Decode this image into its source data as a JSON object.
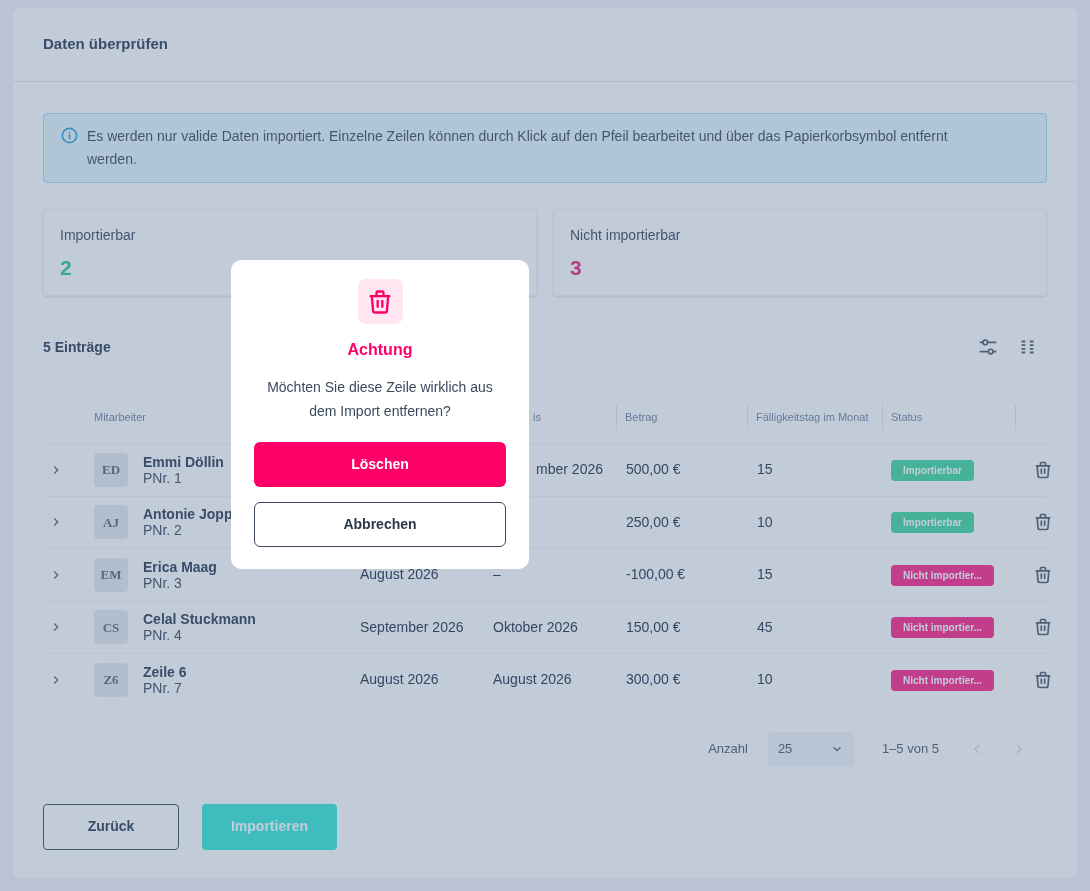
{
  "title": "Daten überprüfen",
  "info": "Es werden nur valide Daten importiert. Einzelne Zeilen können durch Klick auf den Pfeil bearbeitet und über das Papierkorbsymbol entfernt werden.",
  "stats": [
    {
      "label": "Importierbar",
      "value": "2",
      "kind": "ok"
    },
    {
      "label": "Nicht importierbar",
      "value": "3",
      "kind": "error"
    }
  ],
  "entries": "5 Einträge",
  "table": {
    "columns": {
      "employee": "Mitarbeiter",
      "column_4": {
        "label": "is",
        "cut": true
      },
      "amount": "Betrag",
      "due_day": "Fälligkeitstag im Monat",
      "status": "Status"
    },
    "rows": [
      {
        "initials": "ED",
        "name": "Emmi Döllin",
        "pnr": "PNr. 1",
        "column_4": "mber 2026",
        "column_4_cut": true,
        "amount": "500,00 €",
        "due_day": "15",
        "status": {
          "label": "Importierbar",
          "kind": "ok"
        }
      },
      {
        "initials": "AJ",
        "name": "Antonie Jopp",
        "pnr": "PNr. 2",
        "amount": "250,00 €",
        "due_day": "10",
        "status": {
          "label": "Importierbar",
          "kind": "ok"
        }
      },
      {
        "initials": "EM",
        "name": "Erica Maag",
        "pnr": "PNr. 3",
        "column_3": "August 2026",
        "column_4": "–",
        "column_4_cut": false,
        "amount": "-100,00 €",
        "due_day": "15",
        "status": {
          "label": "Nicht importier...",
          "kind": "error"
        }
      },
      {
        "initials": "CS",
        "name": "Celal Stuckmann",
        "pnr": "PNr. 4",
        "column_3": "September 2026",
        "column_4": "Oktober 2026",
        "column_4_cut": false,
        "amount": "150,00 €",
        "due_day": "45",
        "status": {
          "label": "Nicht importier...",
          "kind": "error"
        }
      },
      {
        "initials": "Z6",
        "name": "Zeile 6",
        "pnr": "PNr. 7",
        "column_3": "August 2026",
        "column_4": "August 2026",
        "column_4_cut": false,
        "amount": "300,00 €",
        "due_day": "10",
        "status": {
          "label": "Nicht importier...",
          "kind": "error"
        }
      }
    ]
  },
  "pagination": {
    "label": "Anzahl",
    "page_size": "25",
    "range": "1–5 von 5",
    "prev_disabled": true,
    "next_disabled": true
  },
  "buttons": {
    "back": "Zurück",
    "import": "Importieren"
  },
  "dialog": {
    "title": "Achtung",
    "message": "Möchten Sie diese Zeile wirklich aus dem Import entfernen?",
    "confirm": "Löschen",
    "cancel": "Abbrechen"
  }
}
